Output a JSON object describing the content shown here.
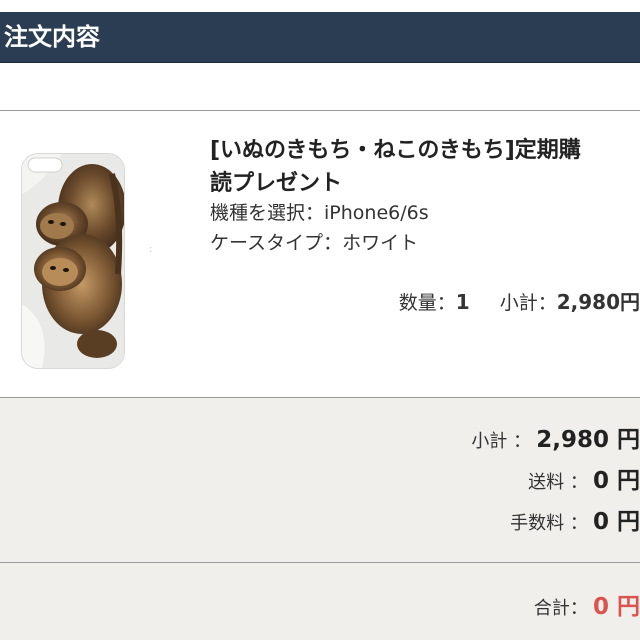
{
  "header": {
    "title": "注文内容"
  },
  "item": {
    "image_icon": "cat-phone-case-image",
    "name_line1": "[いぬのきもち・ねこのきもち]定期購",
    "name_line2": "読プレゼント",
    "options": [
      {
        "label": "機種を選択",
        "sep": "：",
        "value": "iPhone6/6s"
      },
      {
        "label": "ケースタイプ",
        "sep": "：",
        "value": "ホワイト"
      }
    ],
    "quantity_label": "数量：",
    "quantity_value": "1",
    "subtotal_label": "小計：",
    "subtotal_value": "2,980円"
  },
  "totals": {
    "subtotal_label": "小計 ：",
    "subtotal_value": "2,980 円",
    "shipping_label": "送料 ：",
    "shipping_value": "0 円",
    "fee_label": "手数料 ：",
    "fee_value": "0 円",
    "grand_label": "合計：",
    "grand_value": "0 円"
  },
  "colors": {
    "header_bg": "#2b3d52",
    "totals_bg": "#f1efec",
    "grand_total": "#d9534f"
  }
}
